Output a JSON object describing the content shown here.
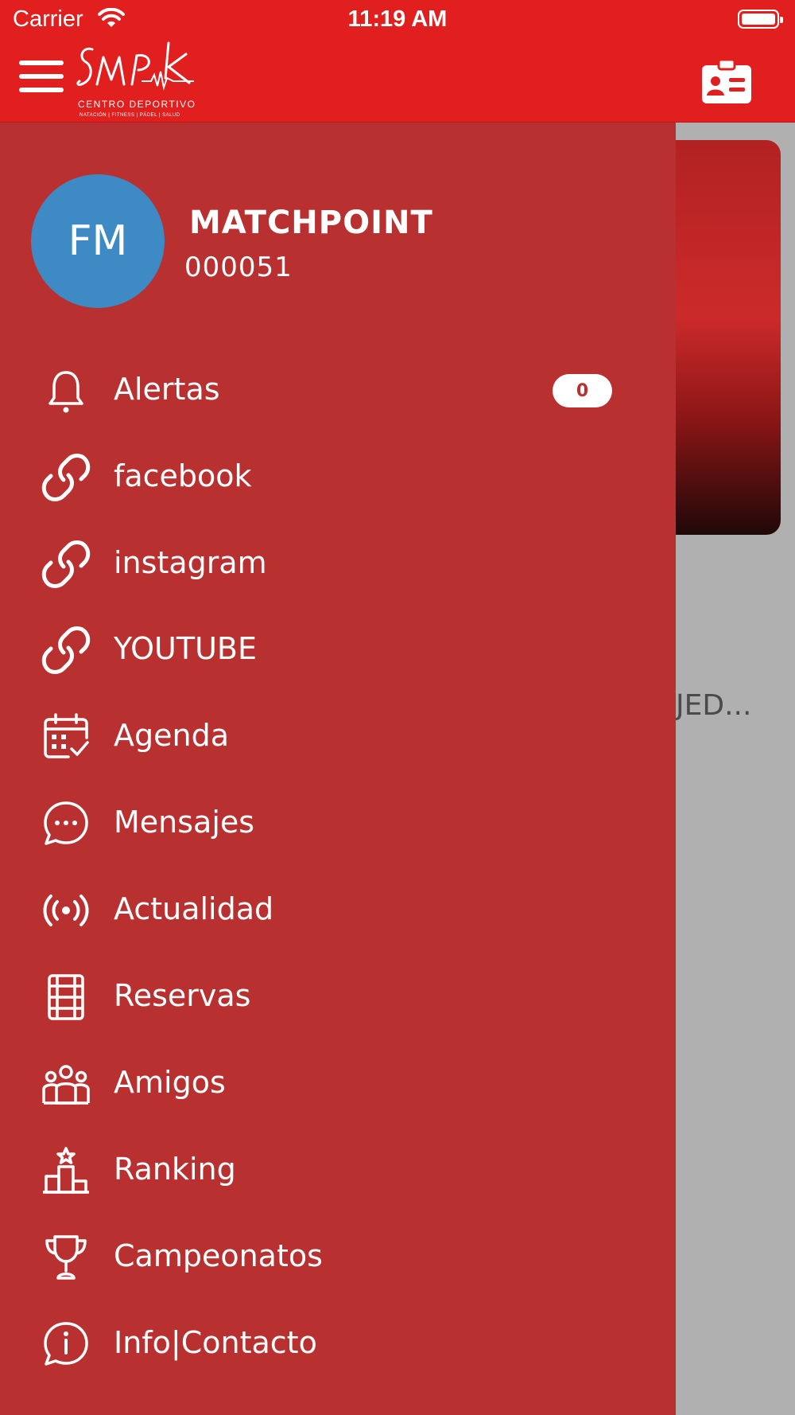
{
  "status_bar": {
    "carrier": "Carrier",
    "time": "11:19 AM"
  },
  "header": {
    "logo_script": "SMP",
    "logo_subtitle": "CENTRO DEPORTIVO",
    "logo_tagline": "NATACIÓN | FITNESS | PÁDEL | SALUD"
  },
  "profile": {
    "initials": "FM",
    "name": "MATCHPOINT",
    "code": "000051"
  },
  "menu": [
    {
      "label": "Alertas",
      "icon": "bell-icon",
      "badge": "0"
    },
    {
      "label": "facebook",
      "icon": "link-icon"
    },
    {
      "label": "instagram",
      "icon": "link-icon"
    },
    {
      "label": "YOUTUBE",
      "icon": "link-icon"
    },
    {
      "label": "Agenda",
      "icon": "calendar-icon"
    },
    {
      "label": "Mensajes",
      "icon": "chat-icon"
    },
    {
      "label": "Actualidad",
      "icon": "broadcast-icon"
    },
    {
      "label": "Reservas",
      "icon": "court-icon"
    },
    {
      "label": "Amigos",
      "icon": "friends-icon"
    },
    {
      "label": "Ranking",
      "icon": "podium-icon"
    },
    {
      "label": "Campeonatos",
      "icon": "trophy-icon"
    },
    {
      "label": "Info|Contacto",
      "icon": "info-chat-icon"
    }
  ],
  "background": {
    "truncated_text": "JED..."
  },
  "colors": {
    "header": "#e11f1f",
    "drawer": "#b93030",
    "avatar": "#3e8ac4"
  }
}
